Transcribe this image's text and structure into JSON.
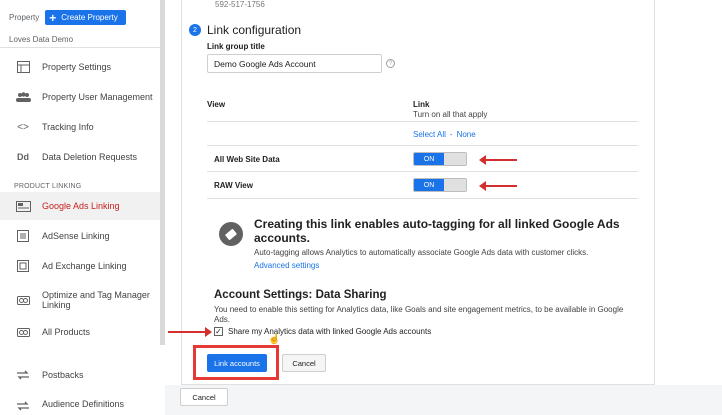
{
  "sidebar": {
    "property_label": "Property",
    "create_property": "Create Property",
    "account": "Loves Data Demo",
    "items": [
      {
        "label": "Property Settings",
        "icon": "property-settings-icon"
      },
      {
        "label": "Property User Management",
        "icon": "users-icon"
      },
      {
        "label": "Tracking Info",
        "icon": "code-icon"
      },
      {
        "label": "Data Deletion Requests",
        "icon": "dd-icon"
      }
    ],
    "section_product_linking": "PRODUCT LINKING",
    "product_items": [
      {
        "label": "Google Ads Linking",
        "icon": "google-ads-icon",
        "active": true
      },
      {
        "label": "AdSense Linking",
        "icon": "adsense-icon"
      },
      {
        "label": "Ad Exchange Linking",
        "icon": "ad-exchange-icon"
      },
      {
        "label_line1": "Optimize and Tag Manager",
        "label_line2": "Linking",
        "icon": "link-icon"
      },
      {
        "label": "All Products",
        "icon": "all-products-icon"
      }
    ],
    "other_items": [
      {
        "label": "Postbacks",
        "icon": "postbacks-icon"
      },
      {
        "label": "Audience Definitions",
        "icon": "audience-icon"
      }
    ]
  },
  "main": {
    "previous_value": "592-517-1756",
    "step_number": "2",
    "step_title": "Link configuration",
    "link_group_label": "Link group title",
    "link_group_value": "Demo Google Ads Account",
    "help_icon": "?",
    "table": {
      "col_view": "View",
      "col_link": "Link",
      "col_link_sub": "Turn on all that apply",
      "select_all": "Select All",
      "separator": "-",
      "none": "None",
      "rows": [
        {
          "label": "All Web Site Data",
          "toggle": "ON"
        },
        {
          "label": "RAW View",
          "toggle": "ON"
        }
      ]
    },
    "info": {
      "title": "Creating this link enables auto-tagging for all linked Google Ads accounts.",
      "description": "Auto-tagging allows Analytics to automatically associate Google Ads data with customer clicks.",
      "link": "Advanced settings"
    },
    "account_settings": {
      "title": "Account Settings: Data Sharing",
      "description": "You need to enable this setting for Analytics data, like Goals and site engagement metrics, to be available in Google Ads.",
      "checkbox_mark": "✓",
      "checkbox_label": "Share my Analytics data with linked Google Ads accounts",
      "checked": true
    },
    "buttons": {
      "link_accounts": "Link accounts",
      "cancel": "Cancel"
    },
    "footer_cancel": "Cancel"
  },
  "colors": {
    "accent": "#1a73e8",
    "active_text": "#c5221f",
    "annotation_red": "#e53935"
  }
}
